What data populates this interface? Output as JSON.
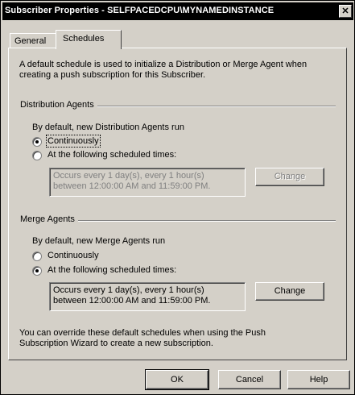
{
  "window": {
    "title": "Subscriber Properties - SELFPACEDCPU\\MYNAMEDINSTANCE",
    "close_glyph": "✕"
  },
  "tabs": [
    {
      "label": "General",
      "selected": false
    },
    {
      "label": "Schedules",
      "selected": true
    }
  ],
  "intro": {
    "line1": "A default schedule is used to initialize a Distribution or Merge Agent when",
    "line2": "creating a push subscription for this Subscriber."
  },
  "distribution": {
    "group_title": "Distribution Agents",
    "prompt": "By default, new Distribution Agents run",
    "option_continuous": {
      "label": "Continuously",
      "selected": true
    },
    "option_scheduled": {
      "label": "At the following scheduled times:",
      "selected": false
    },
    "schedule_text": "Occurs every 1 day(s), every 1 hour(s)\nbetween 12:00:00 AM and 11:59:00 PM.",
    "schedule_enabled": false,
    "change_button": "Change"
  },
  "merge": {
    "group_title": "Merge Agents",
    "prompt": "By default, new Merge Agents run",
    "option_continuous": {
      "label": "Continuously",
      "selected": false
    },
    "option_scheduled": {
      "label": "At the following scheduled times:",
      "selected": true
    },
    "schedule_text": "Occurs every 1 day(s), every 1 hour(s)\nbetween 12:00:00 AM and 11:59:00 PM.",
    "schedule_enabled": true,
    "change_button": "Change"
  },
  "note": {
    "line1": "You can override these default schedules when using the Push",
    "line2": "Subscription Wizard to create a new subscription."
  },
  "buttons": {
    "ok": "OK",
    "cancel": "Cancel",
    "help": "Help"
  },
  "colors": {
    "face": "#d4d0c8",
    "titlebar": "#000000",
    "disabled_text": "#808080"
  }
}
